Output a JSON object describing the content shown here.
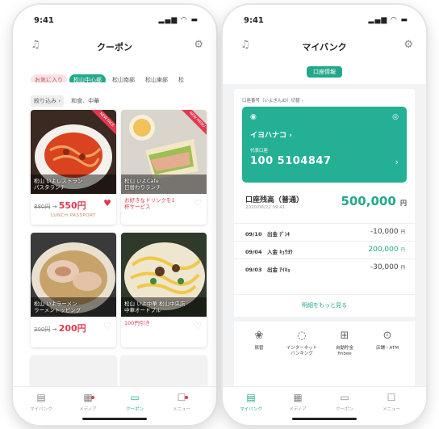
{
  "phone1": {
    "status": {
      "time": "9:41",
      "signal": "▂▄▆ ◠ ▬"
    },
    "title": "クーポン",
    "chips": [
      "お気に入り",
      "松山中心部",
      "松山南部",
      "松山東部",
      "松"
    ],
    "filter": {
      "label": "絞り込み",
      "chevron": "›",
      "value": "和食、中華"
    },
    "cards": [
      {
        "name_line1": "松山 いよレストラン",
        "name_line2": "パスタランチ",
        "old": "880円",
        "arrow": "→",
        "new": "550円",
        "sub": "LUNCH PASSPORT",
        "ribbon": "NEW FACE",
        "favorite": true
      },
      {
        "name_line1": "松山 いよCafe",
        "name_line2": "日替わりランチ",
        "promo_line1": "お好きなドリンクを1",
        "promo_line2": "杯サービス",
        "ribbon": "NEW MENU",
        "favorite": false
      },
      {
        "name_line1": "松山 いよラーメン",
        "name_line2": "ラーメントッピング",
        "old": "300円",
        "arrow": "→",
        "new": "200円",
        "favorite": false
      },
      {
        "name_line1": "松山 いよ中華 松山中央店",
        "name_line2": "中華オードブル",
        "promo_line1": "100円引き",
        "favorite": false
      }
    ],
    "tabs": [
      {
        "label": "マイバンク",
        "icon": "▤",
        "icon_name": "bank-book-icon"
      },
      {
        "label": "メディア",
        "icon": "▦",
        "icon_name": "media-icon"
      },
      {
        "label": "クーポン",
        "icon": "▭",
        "icon_name": "coupon-icon"
      },
      {
        "label": "メニュー",
        "icon": "☐",
        "icon_name": "menu-icon"
      }
    ],
    "icons": {
      "bell": "♫",
      "gear": "⚙"
    }
  },
  "phone2": {
    "status": {
      "time": "9:41",
      "signal": "▂▄▆ ◠ ▬"
    },
    "title": "マイバンク",
    "pill": "口座情報",
    "account_link": "口座番号（いよぎんID）切替 ›",
    "card": {
      "name": "イヨハナコ ›",
      "type": "代表口座",
      "number": "100 5104847",
      "arrow": "›"
    },
    "balance": {
      "label": "口座残高（普通）",
      "date": "2020/06/22 09:41",
      "amount": "500,000",
      "unit": "円"
    },
    "transactions": [
      {
        "date": "09/10",
        "type": "出金",
        "desc": "ﾃﾞﾝｷ",
        "amount": "-10,000",
        "unit": "円",
        "plus": false
      },
      {
        "date": "09/04",
        "type": "入金",
        "desc": "ｷｭｳﾖｳ",
        "amount": "200,000",
        "unit": "円",
        "plus": true
      },
      {
        "date": "09/03",
        "type": "出金",
        "desc": "ｱｲｷｮ",
        "amount": "-30,000",
        "unit": "円",
        "plus": false
      }
    ],
    "more": "明細をもっと見る",
    "services": [
      {
        "line1": "振替",
        "line2": "",
        "icon": "❀",
        "icon_name": "transfer-icon"
      },
      {
        "line1": "インターネット",
        "line2": "バンキング",
        "icon": "◌",
        "icon_name": "internet-banking-icon"
      },
      {
        "line1": "自動貯金",
        "line2": "finbee",
        "icon": "⊞",
        "icon_name": "finbee-icon"
      },
      {
        "line1": "店舗・ATM",
        "line2": "",
        "icon": "⊙",
        "icon_name": "atm-location-icon"
      }
    ],
    "tabs": [
      {
        "label": "マイバンク",
        "icon": "▤",
        "icon_name": "bank-book-icon"
      },
      {
        "label": "メディア",
        "icon": "▦",
        "icon_name": "media-icon"
      },
      {
        "label": "クーポン",
        "icon": "▭",
        "icon_name": "coupon-icon"
      },
      {
        "label": "メニュー",
        "icon": "☐",
        "icon_name": "menu-icon"
      }
    ],
    "icons": {
      "bell": "♫",
      "gear": "⚙",
      "bank_left": "◉",
      "bank_right": "◎"
    }
  },
  "colors": {
    "accent": "#24a88c",
    "price": "#e0394f"
  }
}
